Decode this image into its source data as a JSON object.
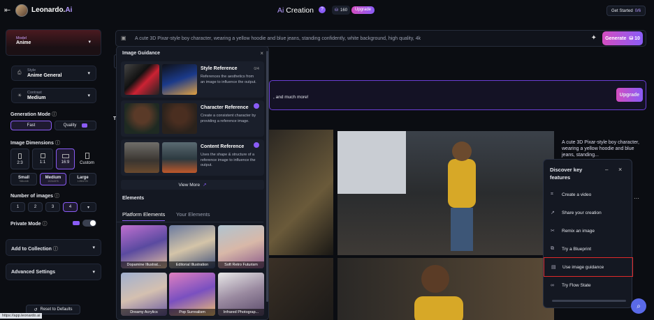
{
  "app": {
    "brand": "Leonardo.",
    "brand_accent": "Ai",
    "page_title_accent": "Ai",
    "page_title": "Creation",
    "tokens": "160",
    "upgrade_label": "Upgrade",
    "get_started": "Get Started",
    "get_started_count": "0/6"
  },
  "sidebar": {
    "model": {
      "label": "Model",
      "value": "Anime"
    },
    "style": {
      "label": "Style",
      "value": "Anime General"
    },
    "contrast": {
      "label": "Contrast",
      "value": "Medium"
    },
    "generation_mode": {
      "title": "Generation Mode",
      "options": [
        "Fast",
        "Quality"
      ]
    },
    "image_dimensions": {
      "title": "Image Dimensions",
      "ratios": [
        "2:3",
        "1:1",
        "16:9",
        "Custom"
      ],
      "sizes": [
        {
          "label": "Small",
          "sub": "768x448"
        },
        {
          "label": "Medium",
          "sub": "1024x576"
        },
        {
          "label": "Large",
          "sub": "1280x720"
        }
      ]
    },
    "num_images": {
      "title": "Number of images",
      "options": [
        "1",
        "2",
        "3",
        "4"
      ]
    },
    "private_mode": "Private Mode",
    "add_to_collection": "Add to Collection",
    "advanced_settings": "Advanced Settings",
    "reset": "Reset to Defaults",
    "status_url": "https://app.leonardo.ai"
  },
  "prompt": {
    "text": "A cute 3D Pixar-style boy character, wearing a yellow hoodie and blue jeans, standing confidently, white background, high quality, 4k",
    "generate_label": "Generate",
    "generate_cost": "10"
  },
  "image_guidance": {
    "title": "Image Guidance",
    "refs": [
      {
        "title": "Style Reference",
        "count": "0/4",
        "desc": "References the aesthetics from an image to influence the output."
      },
      {
        "title": "Character Reference",
        "desc": "Create a consistent character by providing a reference image."
      },
      {
        "title": "Content Reference",
        "desc": "Uses the shape & structure of a reference image to influence the output."
      }
    ],
    "view_more": "View More",
    "elements_title": "Elements",
    "tabs": [
      "Platform Elements",
      "Your Elements"
    ],
    "styles": [
      "Dopamine Illustrat...",
      "Editorial Illustration",
      "Soft Retro Futurism",
      "Dreamy Acrylics",
      "Pop Surrealism",
      "Infrared Photograp..."
    ]
  },
  "banner": {
    "text": ", and much more!",
    "upgrade": "Upgrade"
  },
  "section_letter": "T",
  "result": {
    "prompt_preview": "A cute 3D Pixar-style boy character, wearing a yellow hoodie and blue jeans, standing..."
  },
  "discover": {
    "title": "Discover key features",
    "items": [
      "Create a video",
      "Share your creation",
      "Remix an image",
      "Try a Blueprint",
      "Use image guidance",
      "Try Flow State"
    ]
  }
}
